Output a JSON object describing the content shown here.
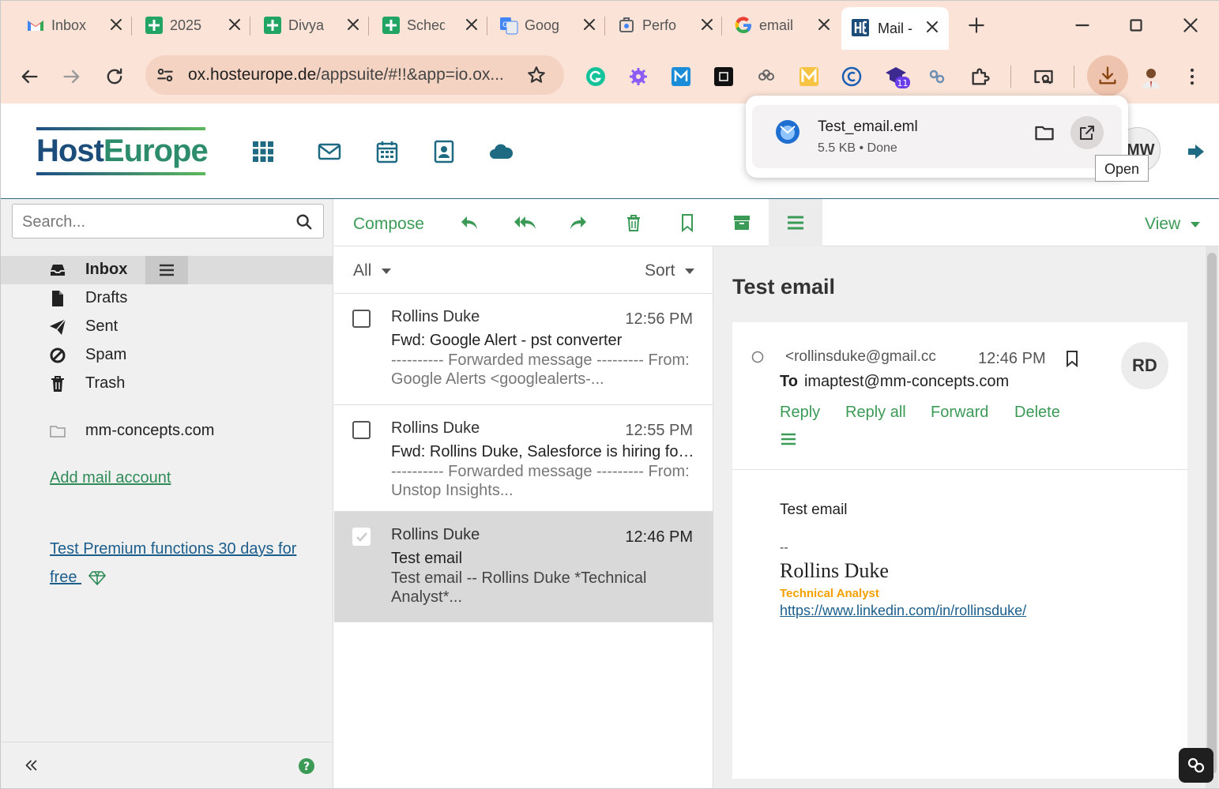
{
  "browser": {
    "tabs": [
      {
        "label": "Inbox",
        "icon": "gmail-icon"
      },
      {
        "label": "2025",
        "icon": "sheets-icon"
      },
      {
        "label": "Divya",
        "icon": "sheets-icon"
      },
      {
        "label": "Sched",
        "icon": "sheets-icon"
      },
      {
        "label": "Goog",
        "icon": "translate-icon"
      },
      {
        "label": "Perfo",
        "icon": "performance-icon"
      },
      {
        "label": "email",
        "icon": "google-icon"
      },
      {
        "label": "Mail -",
        "icon": "hosteurope-icon",
        "active": true
      }
    ],
    "url_host": "ox.hosteurope.de",
    "url_path": "/appsuite/#!!&app=io.ox...",
    "extension_badge": "11"
  },
  "download": {
    "file_name": "Test_email.eml",
    "status": "5.5 KB • Done",
    "tooltip": "Open"
  },
  "app": {
    "logo_host": "Host",
    "logo_europe": "Europe",
    "avatar_initials": "MW"
  },
  "sidebar": {
    "search_placeholder": "Search...",
    "folders": [
      {
        "label": "Inbox",
        "icon": "inbox-icon"
      },
      {
        "label": "Drafts",
        "icon": "drafts-icon"
      },
      {
        "label": "Sent",
        "icon": "sent-icon"
      },
      {
        "label": "Spam",
        "icon": "spam-icon"
      },
      {
        "label": "Trash",
        "icon": "trash-icon"
      }
    ],
    "account_folder": "mm-concepts.com",
    "add_account": "Add mail account",
    "premium": "Test Premium functions 30 days for free"
  },
  "toolbar": {
    "compose": "Compose",
    "view": "View"
  },
  "list": {
    "filter": "All",
    "sort": "Sort",
    "messages": [
      {
        "from": "Rollins Duke",
        "time": "12:56 PM",
        "subject": "Fwd: Google Alert - pst converter",
        "preview": "---------- Forwarded message --------- From: Google Alerts <googlealerts-..."
      },
      {
        "from": "Rollins Duke",
        "time": "12:55 PM",
        "subject": "Fwd: Rollins Duke, Salesforce is hiring for P...",
        "preview": "---------- Forwarded message --------- From: Unstop Insights..."
      },
      {
        "from": "Rollins Duke",
        "time": "12:46 PM",
        "subject": "Test email",
        "preview": "Test email -- Rollins Duke *Technical Analyst*..."
      }
    ]
  },
  "reader": {
    "title": "Test email",
    "from": "<rollinsduke@gmail.cc",
    "time": "12:46 PM",
    "to_label": "To",
    "to": "imaptest@mm-concepts.com",
    "avatar": "RD",
    "actions": {
      "reply": "Reply",
      "reply_all": "Reply all",
      "forward": "Forward",
      "delete": "Delete"
    },
    "body": "Test email",
    "sig_dashes": "--",
    "sig_name": "Rollins Duke",
    "sig_title": "Technical Analyst",
    "sig_link": "https://www.linkedin.com/in/rollinsduke/"
  }
}
